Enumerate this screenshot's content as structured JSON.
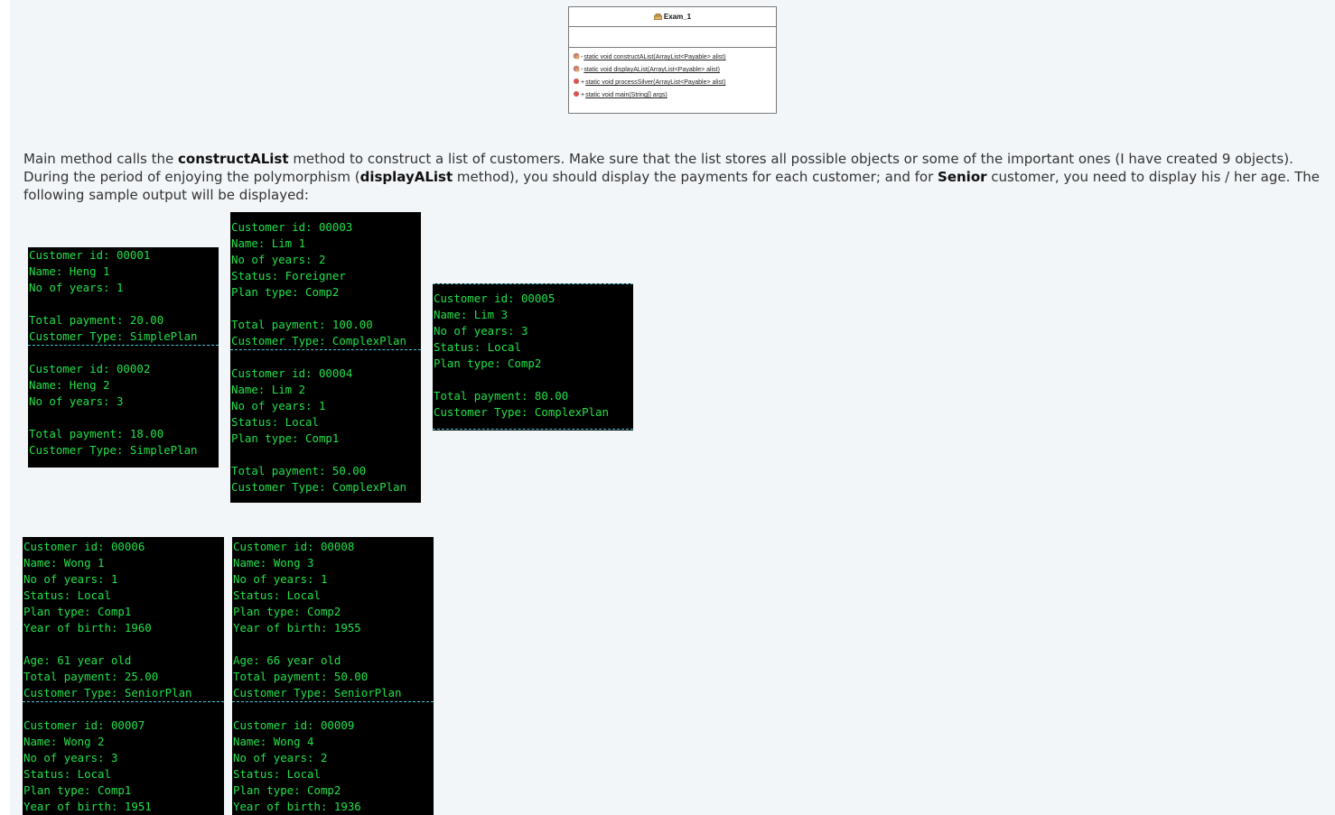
{
  "uml": {
    "title": "Exam_1",
    "methods": [
      {
        "visibility": "-",
        "signature": "static void constructAList(ArrayList<Payable> alist)",
        "icon": "private-method-icon",
        "color": "#c57c74"
      },
      {
        "visibility": "-",
        "signature": "static void displayAList(ArrayList<Payable> alist)",
        "icon": "private-method-icon",
        "color": "#c57c74"
      },
      {
        "visibility": "+",
        "signature": "static void processSilver(ArrayList<Payable> alist)",
        "icon": "public-method-icon",
        "color": "#d9534f"
      },
      {
        "visibility": "+",
        "signature": "static void main(String[] args)",
        "icon": "public-method-icon",
        "color": "#d9534f"
      }
    ]
  },
  "paragraph": {
    "t1": "Main method calls the ",
    "b1": "constructAList",
    "t2": " method to construct a list of customers. Make sure that the list stores all possible objects or some of the important ones (I have created 9 objects). During the period of enjoying the polymorphism (",
    "b2": "displayAList",
    "t3": " method), you should display the payments for each customer; and for ",
    "b3": "Senior",
    "t4": " customer, you need to display his / her age. The following sample output will be displayed:"
  },
  "consoles": {
    "c1": {
      "lines": [
        "Customer id: 00001",
        "Name: Heng 1",
        "No of years: 1",
        "",
        "Total payment: 20.00",
        "Customer Type: SimplePlan",
        "",
        "Customer id: 00002",
        "Name: Heng 2",
        "No of years: 3",
        "",
        "Total payment: 18.00",
        "Customer Type: SimplePlan"
      ]
    },
    "c2": {
      "lines": [
        "Customer id: 00003",
        "Name: Lim 1",
        "No of years: 2",
        "Status: Foreigner",
        "Plan type: Comp2",
        "",
        "Total payment: 100.00",
        "Customer Type: ComplexPlan",
        "",
        "Customer id: 00004",
        "Name: Lim 2",
        "No of years: 1",
        "Status: Local",
        "Plan type: Comp1",
        "",
        "Total payment: 50.00",
        "Customer Type: ComplexPlan"
      ]
    },
    "c3": {
      "lines": [
        "Customer id: 00005",
        "Name: Lim 3",
        "No of years: 3",
        "Status: Local",
        "Plan type: Comp2",
        "",
        "Total payment: 80.00",
        "Customer Type: ComplexPlan"
      ]
    },
    "c4": {
      "lines": [
        "Customer id: 00006",
        "Name: Wong 1",
        "No of years: 1",
        "Status: Local",
        "Plan type: Comp1",
        "Year of birth: 1960",
        "",
        "Age: 61 year old",
        "Total payment: 25.00",
        "Customer Type: SeniorPlan",
        "",
        "Customer id: 00007",
        "Name: Wong 2",
        "No of years: 3",
        "Status: Local",
        "Plan type: Comp1",
        "Year of birth: 1951"
      ]
    },
    "c5": {
      "lines": [
        "Customer id: 00008",
        "Name: Wong 3",
        "No of years: 1",
        "Status: Local",
        "Plan type: Comp2",
        "Year of birth: 1955",
        "",
        "Age: 66 year old",
        "Total payment: 50.00",
        "Customer Type: SeniorPlan",
        "",
        "Customer id: 00009",
        "Name: Wong 4",
        "No of years: 2",
        "Status: Local",
        "Plan type: Comp2",
        "Year of birth: 1936"
      ]
    }
  },
  "colors": {
    "console_text": "#22e04a",
    "console_bg": "#000000",
    "separator": "#4fc6d6"
  }
}
